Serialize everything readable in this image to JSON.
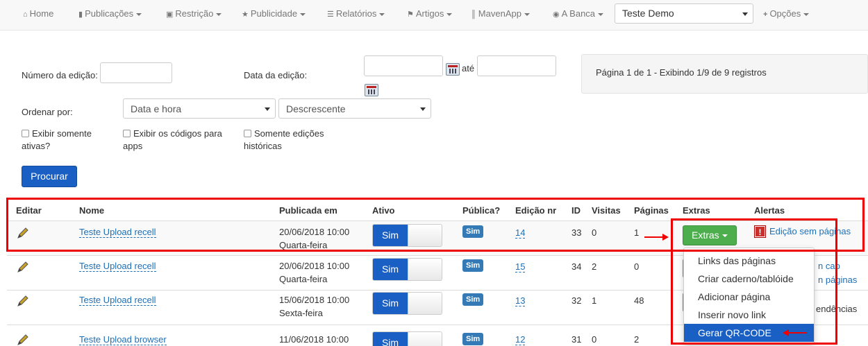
{
  "navbar": {
    "items": [
      {
        "label": "Home",
        "icon": "home-icon",
        "caret": false
      },
      {
        "label": "Publicações",
        "icon": "file-icon",
        "caret": true
      },
      {
        "label": "Restrição",
        "icon": "lock-icon",
        "caret": true
      },
      {
        "label": "Publicidade",
        "icon": "star-icon",
        "caret": true
      },
      {
        "label": "Relatórios",
        "icon": "list-icon",
        "caret": true
      },
      {
        "label": "Artigos",
        "icon": "bookmark-icon",
        "caret": true
      },
      {
        "label": "MavenApp",
        "icon": "barcode-icon",
        "caret": true
      },
      {
        "label": "A Banca",
        "icon": "globe-icon",
        "caret": true
      }
    ],
    "tenant_select": "Teste Demo",
    "options_label": "Opções"
  },
  "filters": {
    "edition_number_label": "Número da edição:",
    "edition_date_label": "Data da edição:",
    "until_label": "até",
    "order_label": "Ordenar por:",
    "order_by_value": "Data e hora",
    "order_dir_value": "Descrescente",
    "checkboxes": [
      {
        "line1": "Exibir somente",
        "line2": "ativas?"
      },
      {
        "line1": "Exibir os códigos para",
        "line2": "apps"
      },
      {
        "line1": "Somente edições",
        "line2": "históricas"
      }
    ],
    "search_button": "Procurar"
  },
  "pagination_info": "Página 1 de 1 - Exibindo 1/9 de 9 registros",
  "table": {
    "headers": [
      "Editar",
      "Nome",
      "Publicada em",
      "Ativo",
      "Pública?",
      "Edição nr",
      "ID",
      "Visitas",
      "Páginas",
      "Extras",
      "Alertas"
    ],
    "rows": [
      {
        "name": "Teste Upload recell",
        "date": "20/06/2018 10:00",
        "weekday": "Quarta-feira",
        "active": "Sim",
        "public": "Sim",
        "edition": "14",
        "id": "33",
        "visits": "0",
        "pages": "1",
        "alert": "Edição sem páginas"
      },
      {
        "name": "Teste Upload recell",
        "date": "20/06/2018 10:00",
        "weekday": "Quarta-feira",
        "active": "Sim",
        "public": "Sim",
        "edition": "15",
        "id": "34",
        "visits": "2",
        "pages": "0",
        "alert_partial_1": "n cap",
        "alert_partial_2": "n páginas"
      },
      {
        "name": "Teste Upload recell",
        "date": "15/06/2018 10:00",
        "weekday": "Sexta-feira",
        "active": "Sim",
        "public": "Sim",
        "edition": "13",
        "id": "32",
        "visits": "1",
        "pages": "48",
        "alert_partial_1": "endências"
      },
      {
        "name": "Teste Upload browser",
        "date": "11/06/2018 10:00",
        "weekday": "",
        "active": "Sim",
        "public": "Sim",
        "edition": "12",
        "id": "31",
        "visits": "0",
        "pages": "2"
      }
    ],
    "extras_button": "Extras"
  },
  "extras_menu": {
    "items": [
      "Links das páginas",
      "Criar caderno/tablóide",
      "Adicionar página",
      "Inserir novo link",
      "Gerar QR-CODE"
    ],
    "active_index": 4
  },
  "colors": {
    "primary": "#1a5fc4",
    "success": "#4cae4c",
    "annotation": "#e00000",
    "link": "#1f6fb5"
  }
}
